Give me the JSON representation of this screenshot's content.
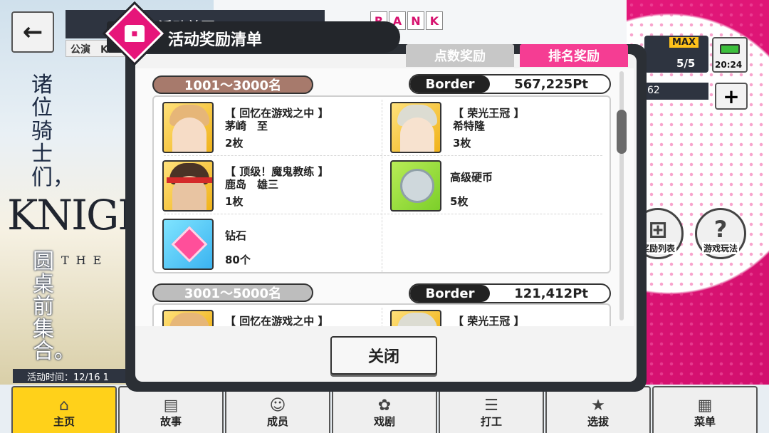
{
  "background": {
    "page_title": "活动首页",
    "event_subtitle": "公演　Kn",
    "rank_letters": [
      "R",
      "A",
      "N",
      "K"
    ],
    "stamina_max_label": "MAX",
    "stamina_value": "5/5",
    "clock_time": "20:24",
    "coin_partial": "62",
    "poem_top": "诸位骑士们，",
    "logo_text": "KNIGH",
    "logo_sub": "THE",
    "poem_bottom": "圆桌前集合。",
    "event_time_label": "活动时间：12/16 1",
    "side_buttons": [
      {
        "label": "奖励列表",
        "icon": "gift-icon"
      },
      {
        "label": "游戏玩法",
        "icon": "question-icon"
      }
    ]
  },
  "nav": [
    {
      "label": "主页",
      "icon": "home-icon",
      "glyph": "⌂",
      "active": true
    },
    {
      "label": "故事",
      "icon": "book-icon",
      "glyph": "▤",
      "active": false
    },
    {
      "label": "成员",
      "icon": "members-icon",
      "glyph": "☺",
      "active": false
    },
    {
      "label": "戏剧",
      "icon": "theater-icon",
      "glyph": "✿",
      "active": false
    },
    {
      "label": "打工",
      "icon": "work-icon",
      "glyph": "☰",
      "active": false
    },
    {
      "label": "选拔",
      "icon": "star-icon",
      "glyph": "★",
      "active": false
    },
    {
      "label": "菜单",
      "icon": "menu-grid-icon",
      "glyph": "▦",
      "active": false
    }
  ],
  "modal": {
    "title": "活动奖励清单",
    "tabs": {
      "points": "点数奖励",
      "ranking": "排名奖励",
      "active": "ranking"
    },
    "tiers": [
      {
        "range": "1001～3000名",
        "border_label": "Border",
        "border_value": "567,225Pt",
        "rewards": [
          {
            "title": "【 回忆在游戏之中 】",
            "name": "茅崎　至",
            "qty": "2枚"
          },
          {
            "title": "【 荣光王冠 】",
            "name": "希特隆",
            "qty": "3枚"
          },
          {
            "title": "【 顶级！魔鬼教练 】",
            "name": "鹿岛　雄三",
            "qty": "1枚"
          },
          {
            "name": "高级硬币",
            "qty": "5枚"
          },
          {
            "name": "钻石",
            "qty": "80个"
          }
        ]
      },
      {
        "range": "3001～5000名",
        "border_label": "Border",
        "border_value": "121,412Pt",
        "rewards": [
          {
            "title": "【 回忆在游戏之中 】"
          },
          {
            "title": "【 荣光王冠 】"
          }
        ]
      }
    ],
    "close_label": "关闭"
  },
  "colors": {
    "accent_pink": "#f53d93",
    "header_dark": "#23262b",
    "tier1_pill": "#a77a6c",
    "tier2_pill": "#bdbdbd"
  }
}
